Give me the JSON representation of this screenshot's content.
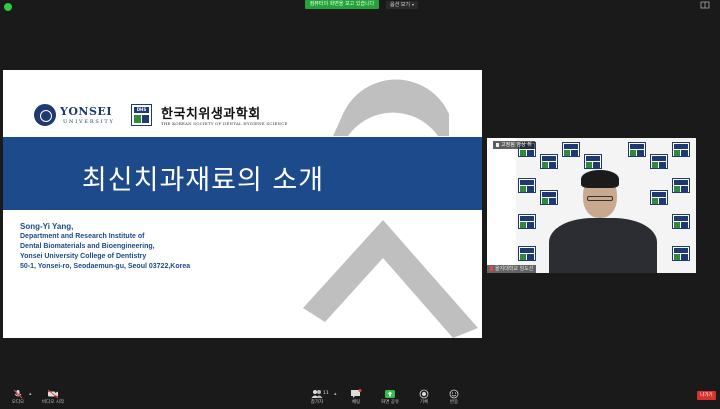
{
  "top_bar": {
    "share_banner": "컴퓨터의 화면을 보고 있습니다",
    "view_options": "옵션 보기"
  },
  "slide": {
    "university_name": "YONSEI",
    "university_sub": "UNIVERSITY",
    "society_name": "한국치위생과학회",
    "society_sub": "THE KOREAN SOCIETY OF DENTAL HYGIENE SCIENCE",
    "society_logo_text": "DHS",
    "title": "최신치과재료의 소개",
    "author_lines": [
      "Song-Yi Yang,",
      "Department and Research Institute of",
      "Dental Biomaterials and Bioengineering,",
      "Yonsei University College of Dentistry",
      "50-1, Yonsei-ro, Seodaemun-gu, Seoul 03722,Korea"
    ]
  },
  "video": {
    "pin_label": "고정됨 영상 취",
    "participant_name": "을지대학교 임도선"
  },
  "toolbar": {
    "mute_label": "오디오",
    "video_label": "비디오 시작",
    "participants_label": "참가자",
    "participants_count": "11",
    "chat_label": "채팅",
    "share_label": "화면 공유",
    "record_label": "기록",
    "reactions_label": "반응",
    "leave_label": "나가기"
  },
  "colors": {
    "slide_band": "#1d4a8a",
    "share_green": "#23a33a",
    "leave_red": "#d8322c"
  }
}
